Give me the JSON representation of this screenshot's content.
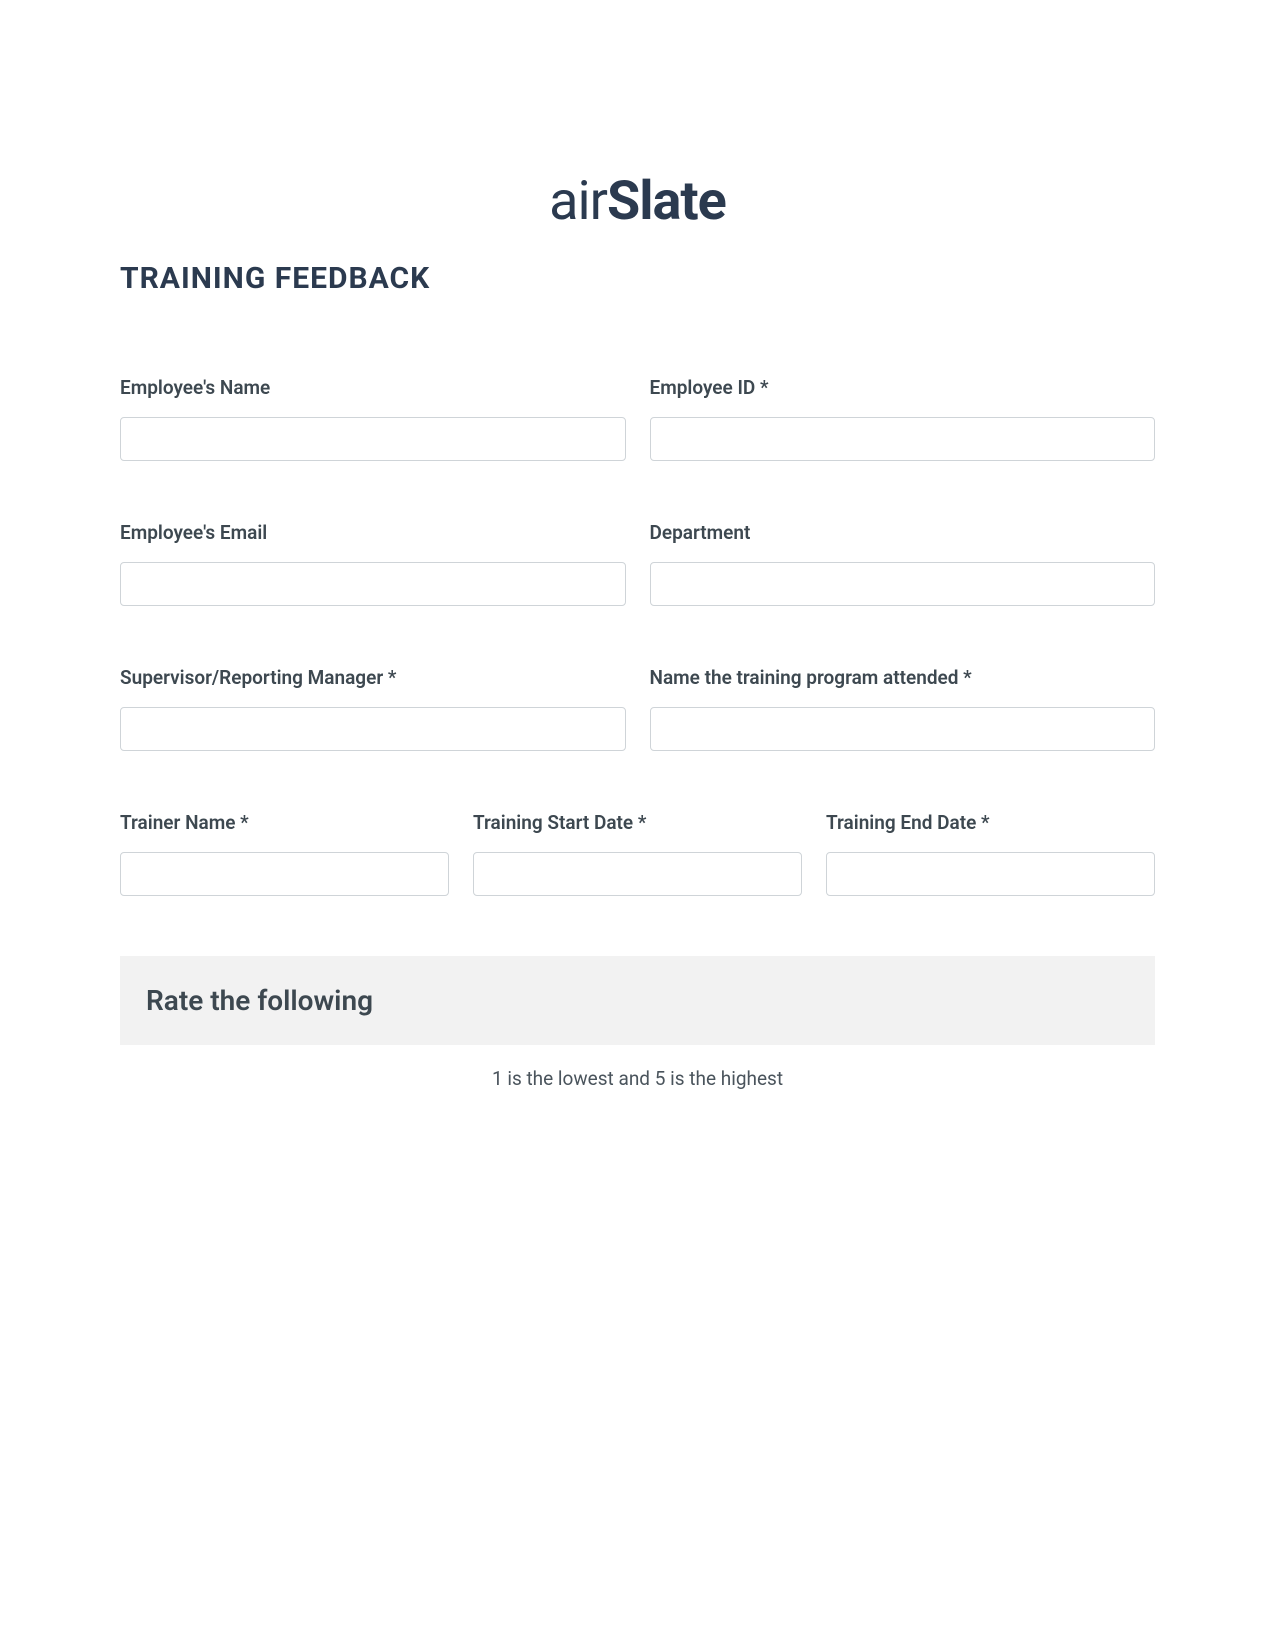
{
  "brand": {
    "name_prefix": "air",
    "name_suffix": "Slate"
  },
  "title": "TRAINING FEEDBACK",
  "fields": {
    "employee_name": {
      "label": "Employee's Name",
      "value": ""
    },
    "employee_id": {
      "label": "Employee ID *",
      "value": ""
    },
    "employee_email": {
      "label": "Employee's Email",
      "value": ""
    },
    "department": {
      "label": "Department",
      "value": ""
    },
    "supervisor": {
      "label": "Supervisor/Reporting Manager *",
      "value": ""
    },
    "training_program": {
      "label": "Name the training program attended *",
      "value": ""
    },
    "trainer_name": {
      "label": "Trainer Name *",
      "value": ""
    },
    "training_start": {
      "label": "Training Start Date *",
      "value": ""
    },
    "training_end": {
      "label": "Training End Date *",
      "value": ""
    }
  },
  "rating_section": {
    "title": "Rate the following",
    "subtitle": "1 is the lowest and 5 is the highest"
  }
}
